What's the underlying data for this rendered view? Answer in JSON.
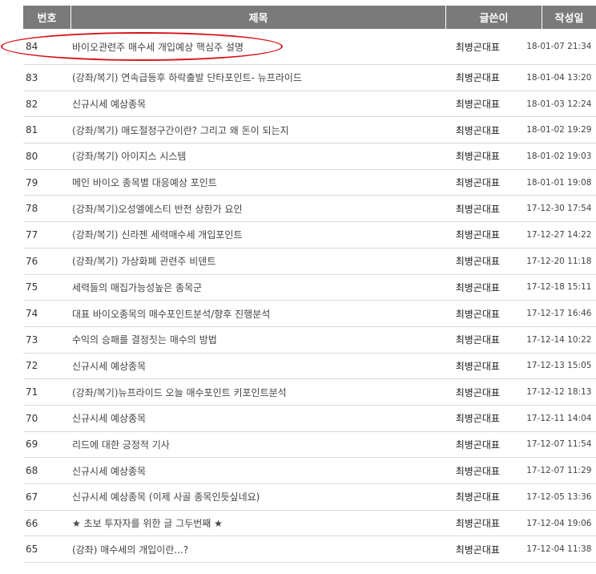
{
  "header": {
    "num": "번호",
    "title": "제목",
    "author": "글쓴이",
    "date": "작성일"
  },
  "rows": [
    {
      "num": "84",
      "title": "바이오관련주 매수세 개입예상 핵심주 설명",
      "author": "최병곤대표",
      "date": "18-01-07 21:34"
    },
    {
      "num": "83",
      "title": "(강좌/복기) 연속급등후 하락출발 단타포인트- 뉴프라이드",
      "author": "최병곤대표",
      "date": "18-01-04 13:20"
    },
    {
      "num": "82",
      "title": "신규시세 예상종목",
      "author": "최병곤대표",
      "date": "18-01-03 12:24"
    },
    {
      "num": "81",
      "title": "(강좌/복기) 매도절정구간이란? 그리고 왜 돈이 되는지",
      "author": "최병곤대표",
      "date": "18-01-02 19:29"
    },
    {
      "num": "80",
      "title": "(강좌/복기) 아이지스 시스템",
      "author": "최병곤대표",
      "date": "18-01-02 19:03"
    },
    {
      "num": "79",
      "title": "메인 바이오 종목별 대응예상 포인트",
      "author": "최병곤대표",
      "date": "18-01-01 19:08"
    },
    {
      "num": "78",
      "title": "(강좌/복기)오성엘에스티 반전 상한가 요인",
      "author": "최병곤대표",
      "date": "17-12-30 17:54"
    },
    {
      "num": "77",
      "title": "(강좌/복기) 신라젠 세력매수세 개입포인트",
      "author": "최병곤대표",
      "date": "17-12-27 14:22"
    },
    {
      "num": "76",
      "title": "(강좌/복기) 가상화폐 관련주 비덴트",
      "author": "최병곤대표",
      "date": "17-12-20 11:18"
    },
    {
      "num": "75",
      "title": "세력들의 매집가능성높은 종목군",
      "author": "최병곤대표",
      "date": "17-12-18 15:11"
    },
    {
      "num": "74",
      "title": "대표 바이오종목의 매수포인트분석/향후 진행분석",
      "author": "최병곤대표",
      "date": "17-12-17 16:46"
    },
    {
      "num": "73",
      "title": "수익의 승패를 결정짓는 매수의 방법",
      "author": "최병곤대표",
      "date": "17-12-14 10:22"
    },
    {
      "num": "72",
      "title": "신규시세 예상종목",
      "author": "최병곤대표",
      "date": "17-12-13 15:05"
    },
    {
      "num": "71",
      "title": "(강좌/복기)뉴프라이드 오늘 매수포인트 키포인트분석",
      "author": "최병곤대표",
      "date": "17-12-12 18:13"
    },
    {
      "num": "70",
      "title": "신규시세 예상종목",
      "author": "최병곤대표",
      "date": "17-12-11 14:04"
    },
    {
      "num": "69",
      "title": "리드에 대한 긍정적 기사",
      "author": "최병곤대표",
      "date": "17-12-07 11:54"
    },
    {
      "num": "68",
      "title": "신규시세 예상종목",
      "author": "최병곤대표",
      "date": "17-12-07 11:29"
    },
    {
      "num": "67",
      "title": "신규시세 예상종목 (이제 사골 종목인듯싶네요)",
      "author": "최병곤대표",
      "date": "17-12-05 13:36"
    },
    {
      "num": "66",
      "title": "★ 초보 투자자를 위한 글 그두번째 ★",
      "author": "최병곤대표",
      "date": "17-12-04 19:06"
    },
    {
      "num": "65",
      "title": "(강좌) 매수세의 개입이란...?",
      "author": "최병곤대표",
      "date": "17-12-04 11:38"
    }
  ],
  "colors": {
    "header_bg": "#7a7a7a",
    "highlight": "#d8141b"
  }
}
